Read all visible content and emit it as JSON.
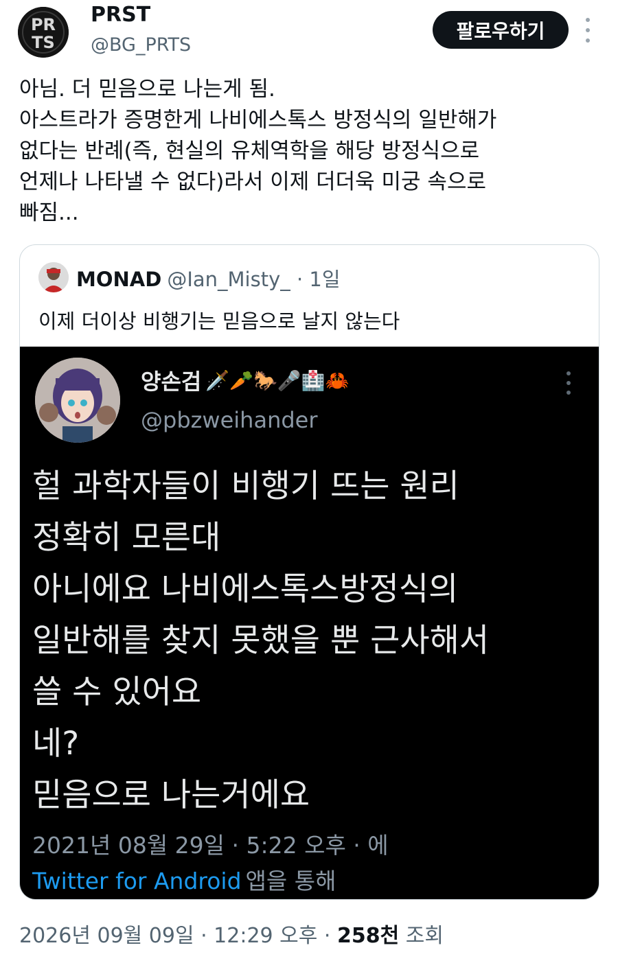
{
  "tweet": {
    "author_name": "PRST",
    "author_handle": "@BG_PRTS",
    "follow_label": "팔로우하기",
    "text_lines": [
      "아님. 더 믿음으로 나는게 됨.",
      "아스트라가 증명한게 나비에스톡스 방정식의 일반해가",
      "없다는 반례(즉, 현실의 유체역학을 해당 방정식으로",
      "언제나 나타낼 수 없다)라서 이제 더더욱 미궁 속으로",
      "빠짐..."
    ],
    "timestamp": "2026년 09월 09일 · 12:29 오후 ·",
    "views_count": "258천",
    "views_label": "조회"
  },
  "quote": {
    "author_name": "MONAD",
    "author_handle": "@Ian_Misty_",
    "time": "· 1일",
    "text": "이제 더이상 비행기는 믿음으로 날지 않는다"
  },
  "embedded": {
    "author_name": "양손검",
    "author_emojis": "🗡️🥕🐎🎤🏥🦀",
    "author_handle": "@pbzweihander",
    "text_lines": [
      "헐 과학자들이 비행기 뜨는 원리",
      "정확히 모른대",
      "아니에요 나비에스톡스방정식의",
      "일반해를 찾지 못했을 뿐 근사해서",
      "쓸 수 있어요",
      "네?",
      "믿음으로 나는거에요"
    ],
    "date": "2021년 08월 29일 · 5:22 오후 · 에",
    "source_link": "Twitter for Android",
    "source_rest": "앱을 통해"
  },
  "avatar_text": {
    "line1": "PR",
    "line2": "TS"
  },
  "colors": {
    "primary_text": "#0f1419",
    "secondary_text": "#536471",
    "link_blue": "#1d9bf0",
    "border": "#cfd9de",
    "follow_bg": "#0f1419"
  }
}
